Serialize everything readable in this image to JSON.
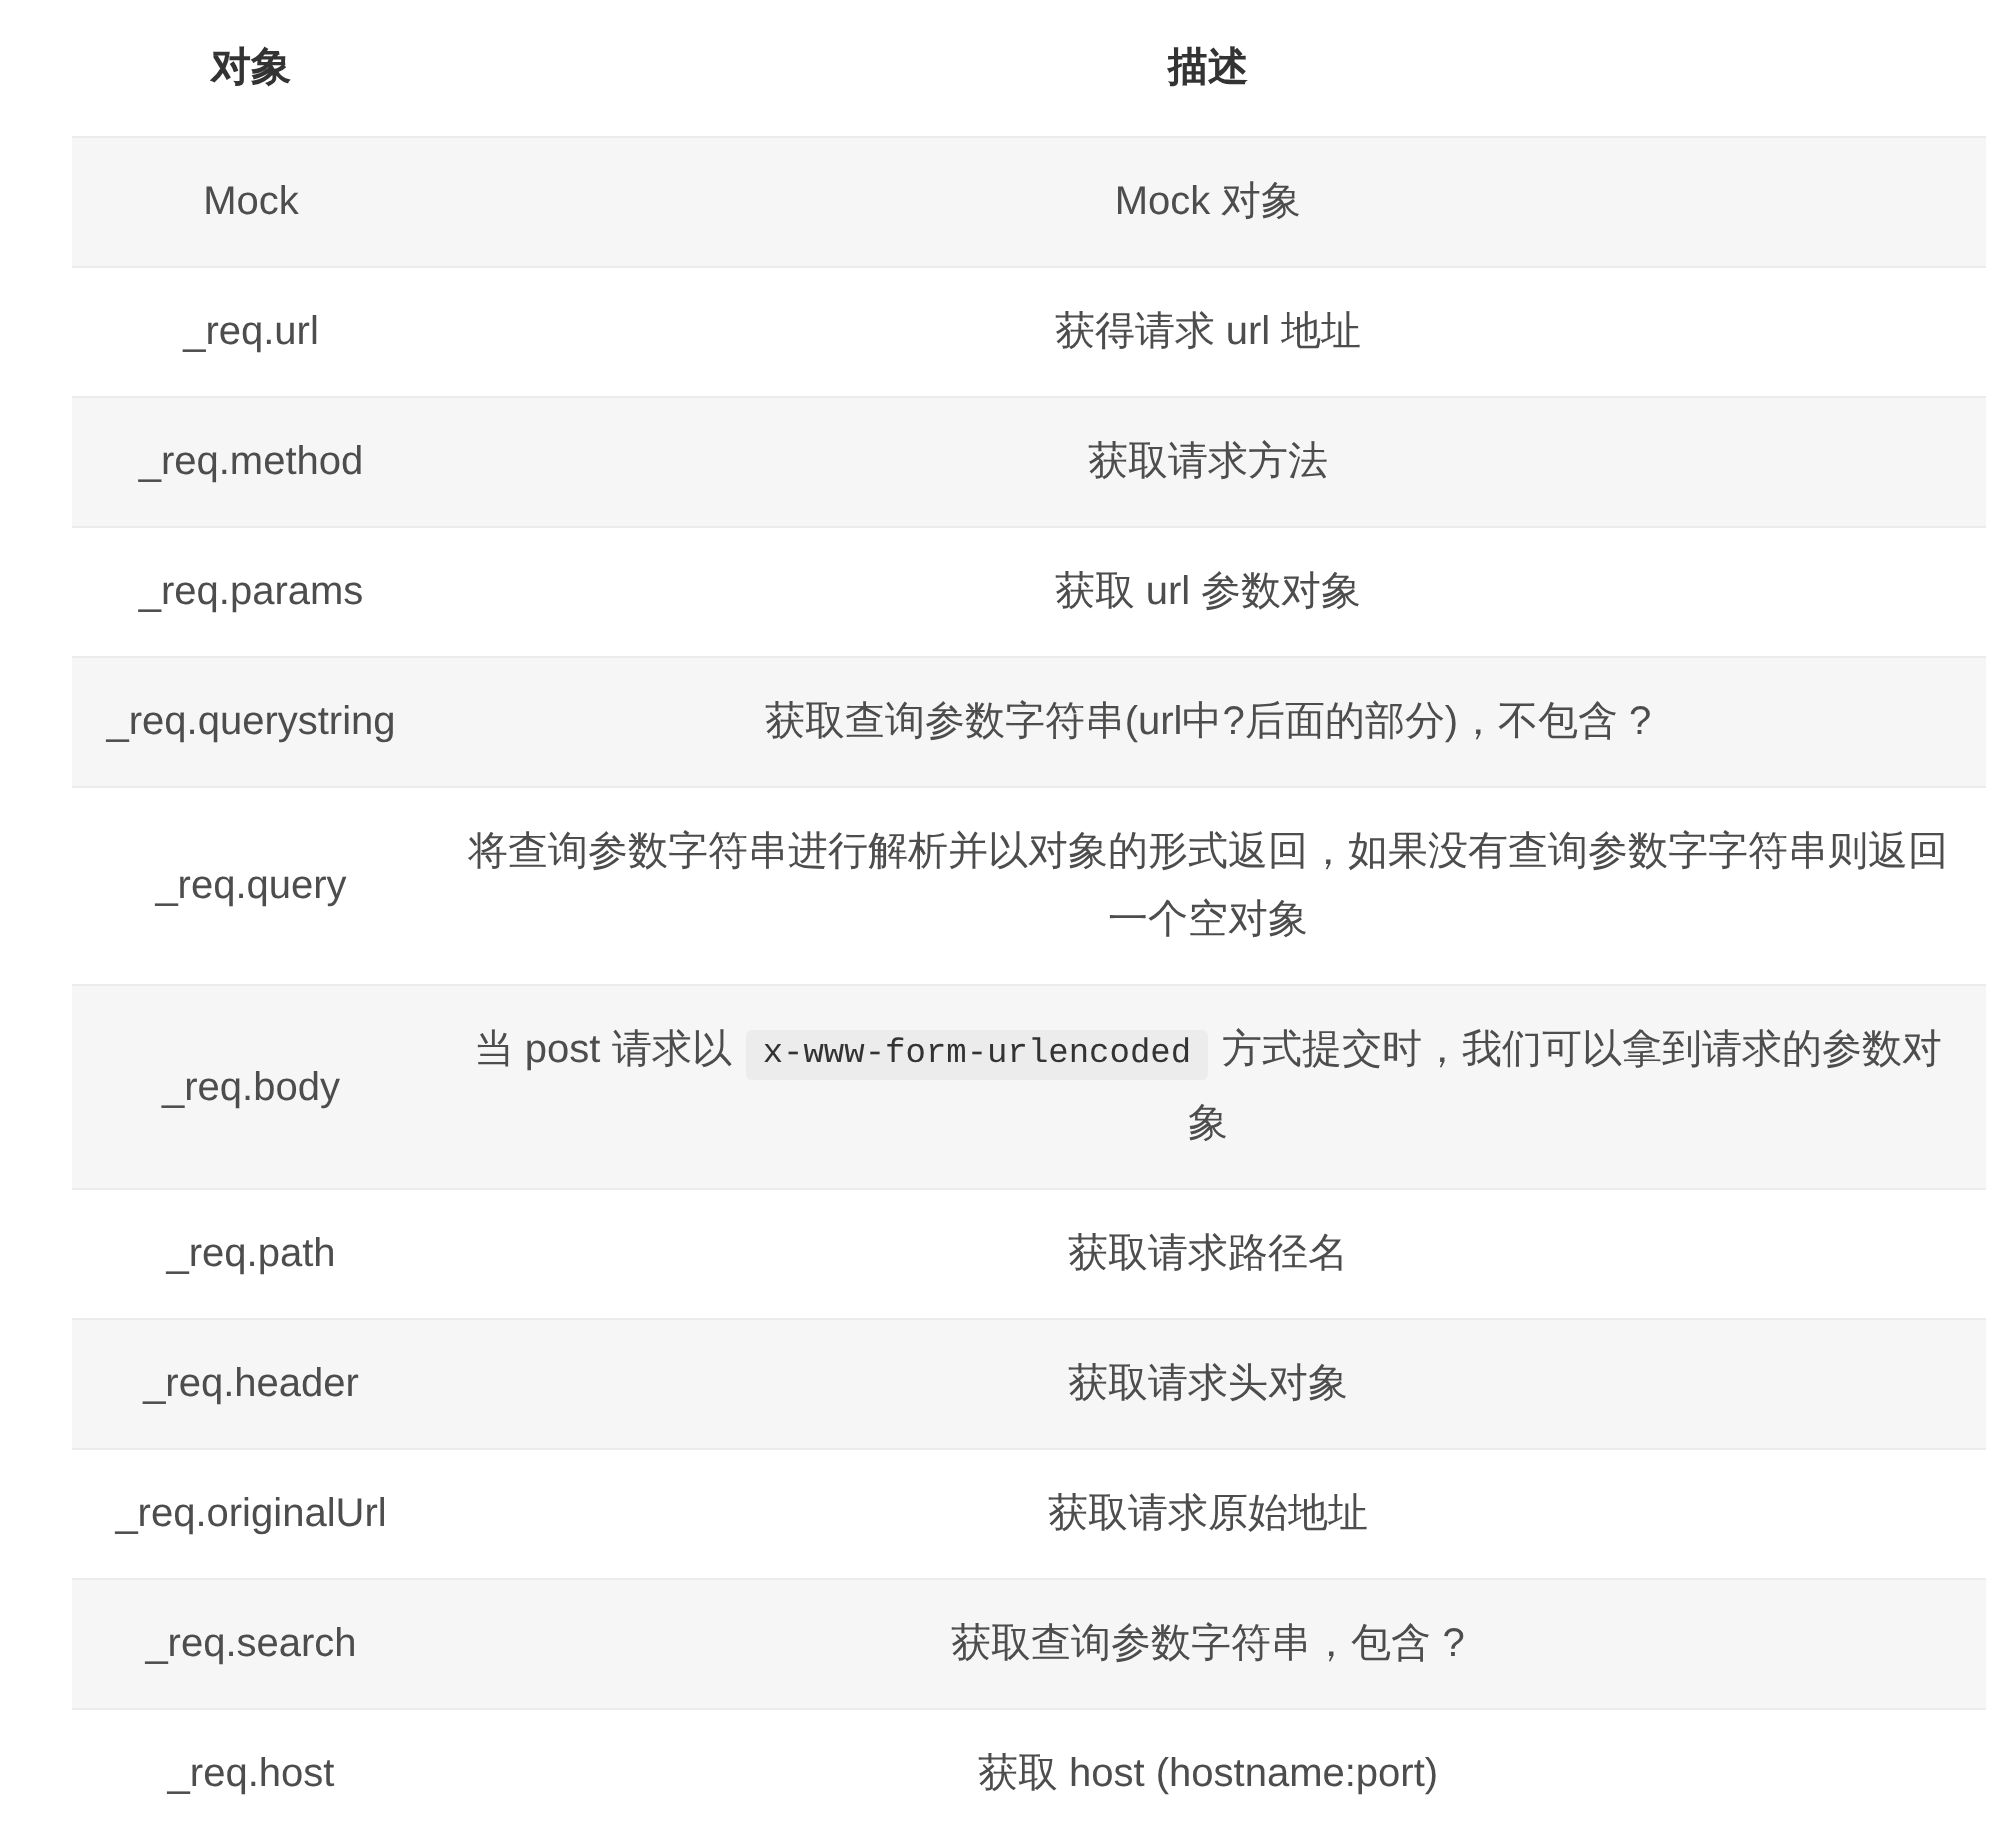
{
  "table": {
    "columns": [
      "对象",
      "描述"
    ],
    "rows": [
      {
        "object": "Mock",
        "description": "Mock 对象"
      },
      {
        "object": "_req.url",
        "description": "获得请求 url 地址"
      },
      {
        "object": "_req.method",
        "description": "获取请求方法"
      },
      {
        "object": "_req.params",
        "description": "获取 url 参数对象"
      },
      {
        "object": "_req.querystring",
        "description": "获取查询参数字符串(url中?后面的部分)，不包含 ?"
      },
      {
        "object": "_req.query",
        "description": "将查询参数字符串进行解析并以对象的形式返回，如果没有查询参数字字符串则返回一个空对象"
      },
      {
        "object": "_req.body",
        "parts": [
          {
            "kind": "text",
            "text": "当 post 请求以 "
          },
          {
            "kind": "code",
            "text": "x-www-form-urlencoded"
          },
          {
            "kind": "text",
            "text": " 方式提交时，我们可以拿到请求的参数对象"
          }
        ]
      },
      {
        "object": "_req.path",
        "description": "获取请求路径名"
      },
      {
        "object": "_req.header",
        "description": "获取请求头对象"
      },
      {
        "object": "_req.originalUrl",
        "description": "获取请求原始地址"
      },
      {
        "object": "_req.search",
        "description": "获取查询参数字符串，包含 ?"
      },
      {
        "object": "_req.host",
        "description": "获取 host (hostname:port)"
      }
    ]
  }
}
